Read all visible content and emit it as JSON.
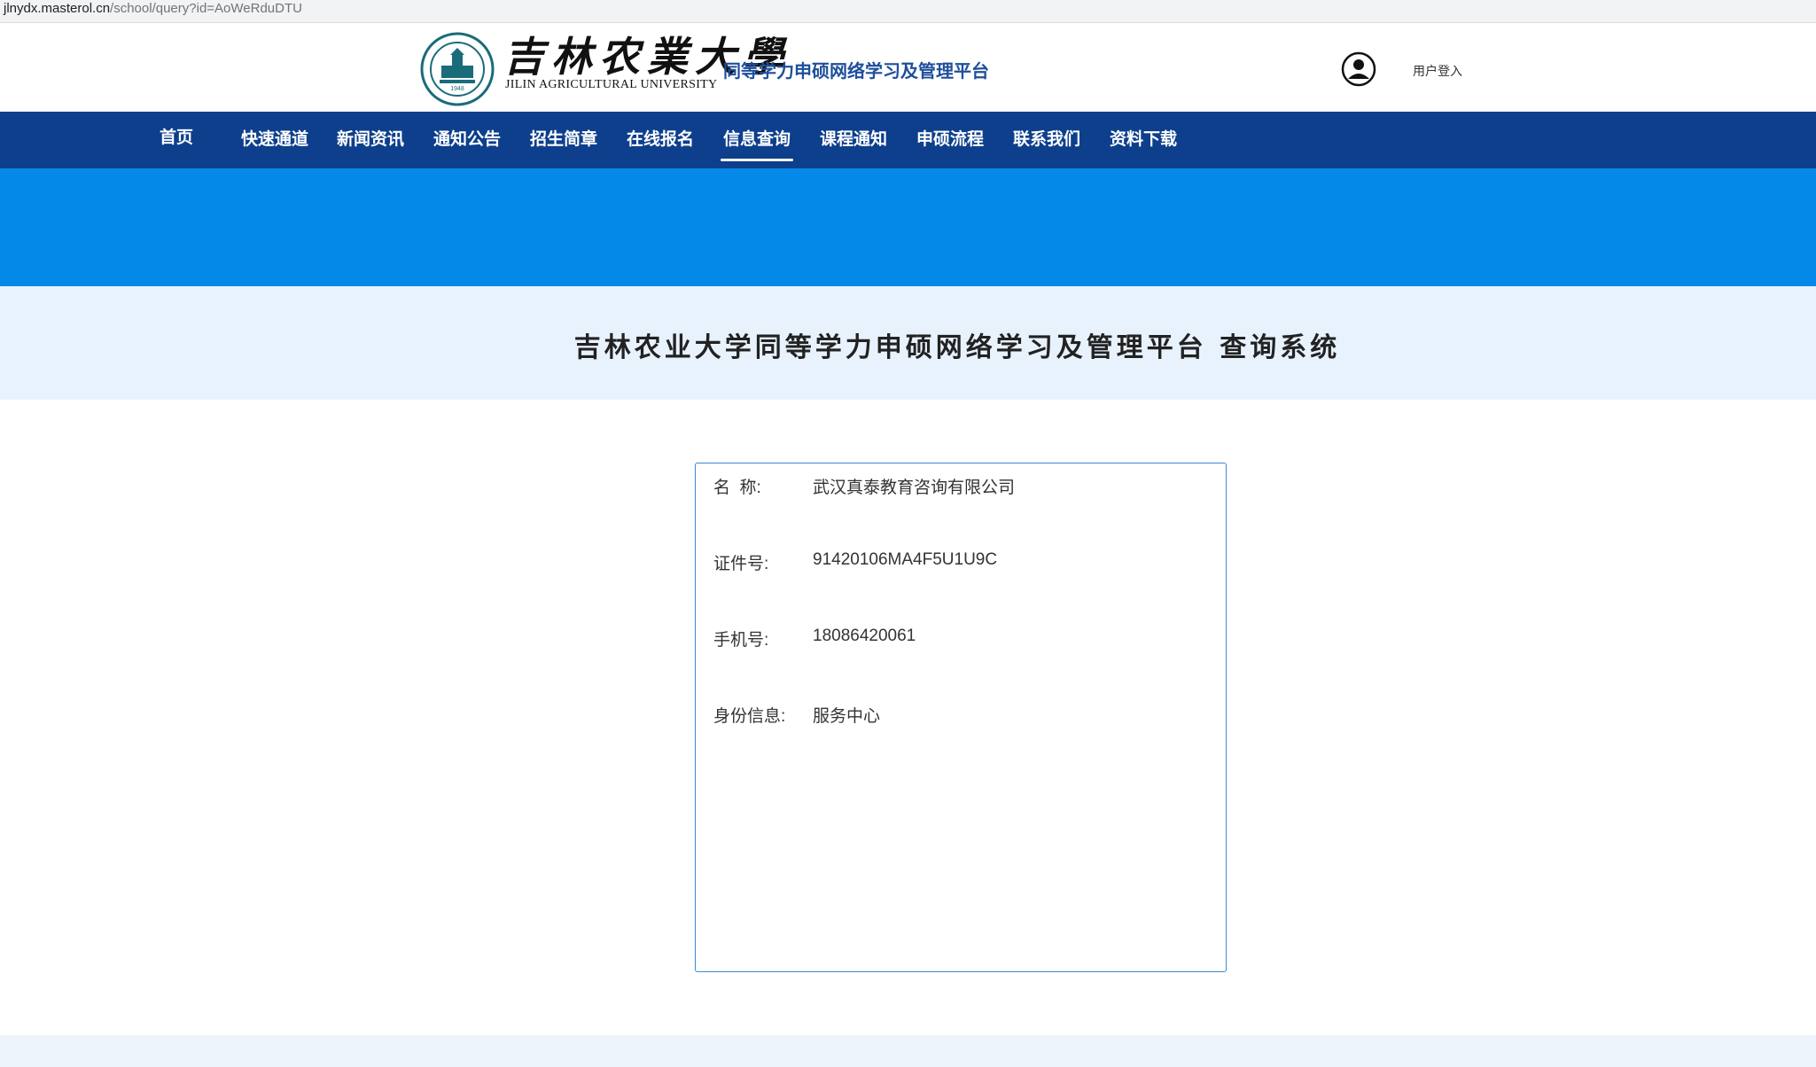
{
  "browser": {
    "url_domain": "jlnydx.masterol.cn",
    "url_path": "/school/query?id=AoWeRduDTU"
  },
  "header": {
    "school_name_cn": "吉林农業大學",
    "school_name_en": "JILIN AGRICULTURAL UNIVERSITY",
    "logo_year": "1948",
    "platform_name": "同等学力申硕网络学习及管理平台",
    "login_label": "用户登入"
  },
  "nav": {
    "items": [
      {
        "label": "首页"
      },
      {
        "label": "快速通道"
      },
      {
        "label": "新闻资讯"
      },
      {
        "label": "通知公告"
      },
      {
        "label": "招生简章"
      },
      {
        "label": "在线报名"
      },
      {
        "label": "信息查询",
        "active": true
      },
      {
        "label": "课程通知"
      },
      {
        "label": "申硕流程"
      },
      {
        "label": "联系我们"
      },
      {
        "label": "资料下载"
      }
    ]
  },
  "page": {
    "title": "吉林农业大学同等学力申硕网络学习及管理平台 查询系统"
  },
  "result": {
    "name_label": "名  称:",
    "name_value": "武汉真泰教育咨询有限公司",
    "cert_label": "证件号:",
    "cert_value": "91420106MA4F5U1U9C",
    "phone_label": "手机号:",
    "phone_value": "18086420061",
    "identity_label": "身份信息:",
    "identity_value": "服务中心"
  },
  "colors": {
    "nav_bg": "#0d3f8c",
    "banner_bg": "#0589e8",
    "title_band_bg": "#e8f2fd",
    "platform_text": "#1e4f9c",
    "card_border": "#3a8ad6"
  }
}
